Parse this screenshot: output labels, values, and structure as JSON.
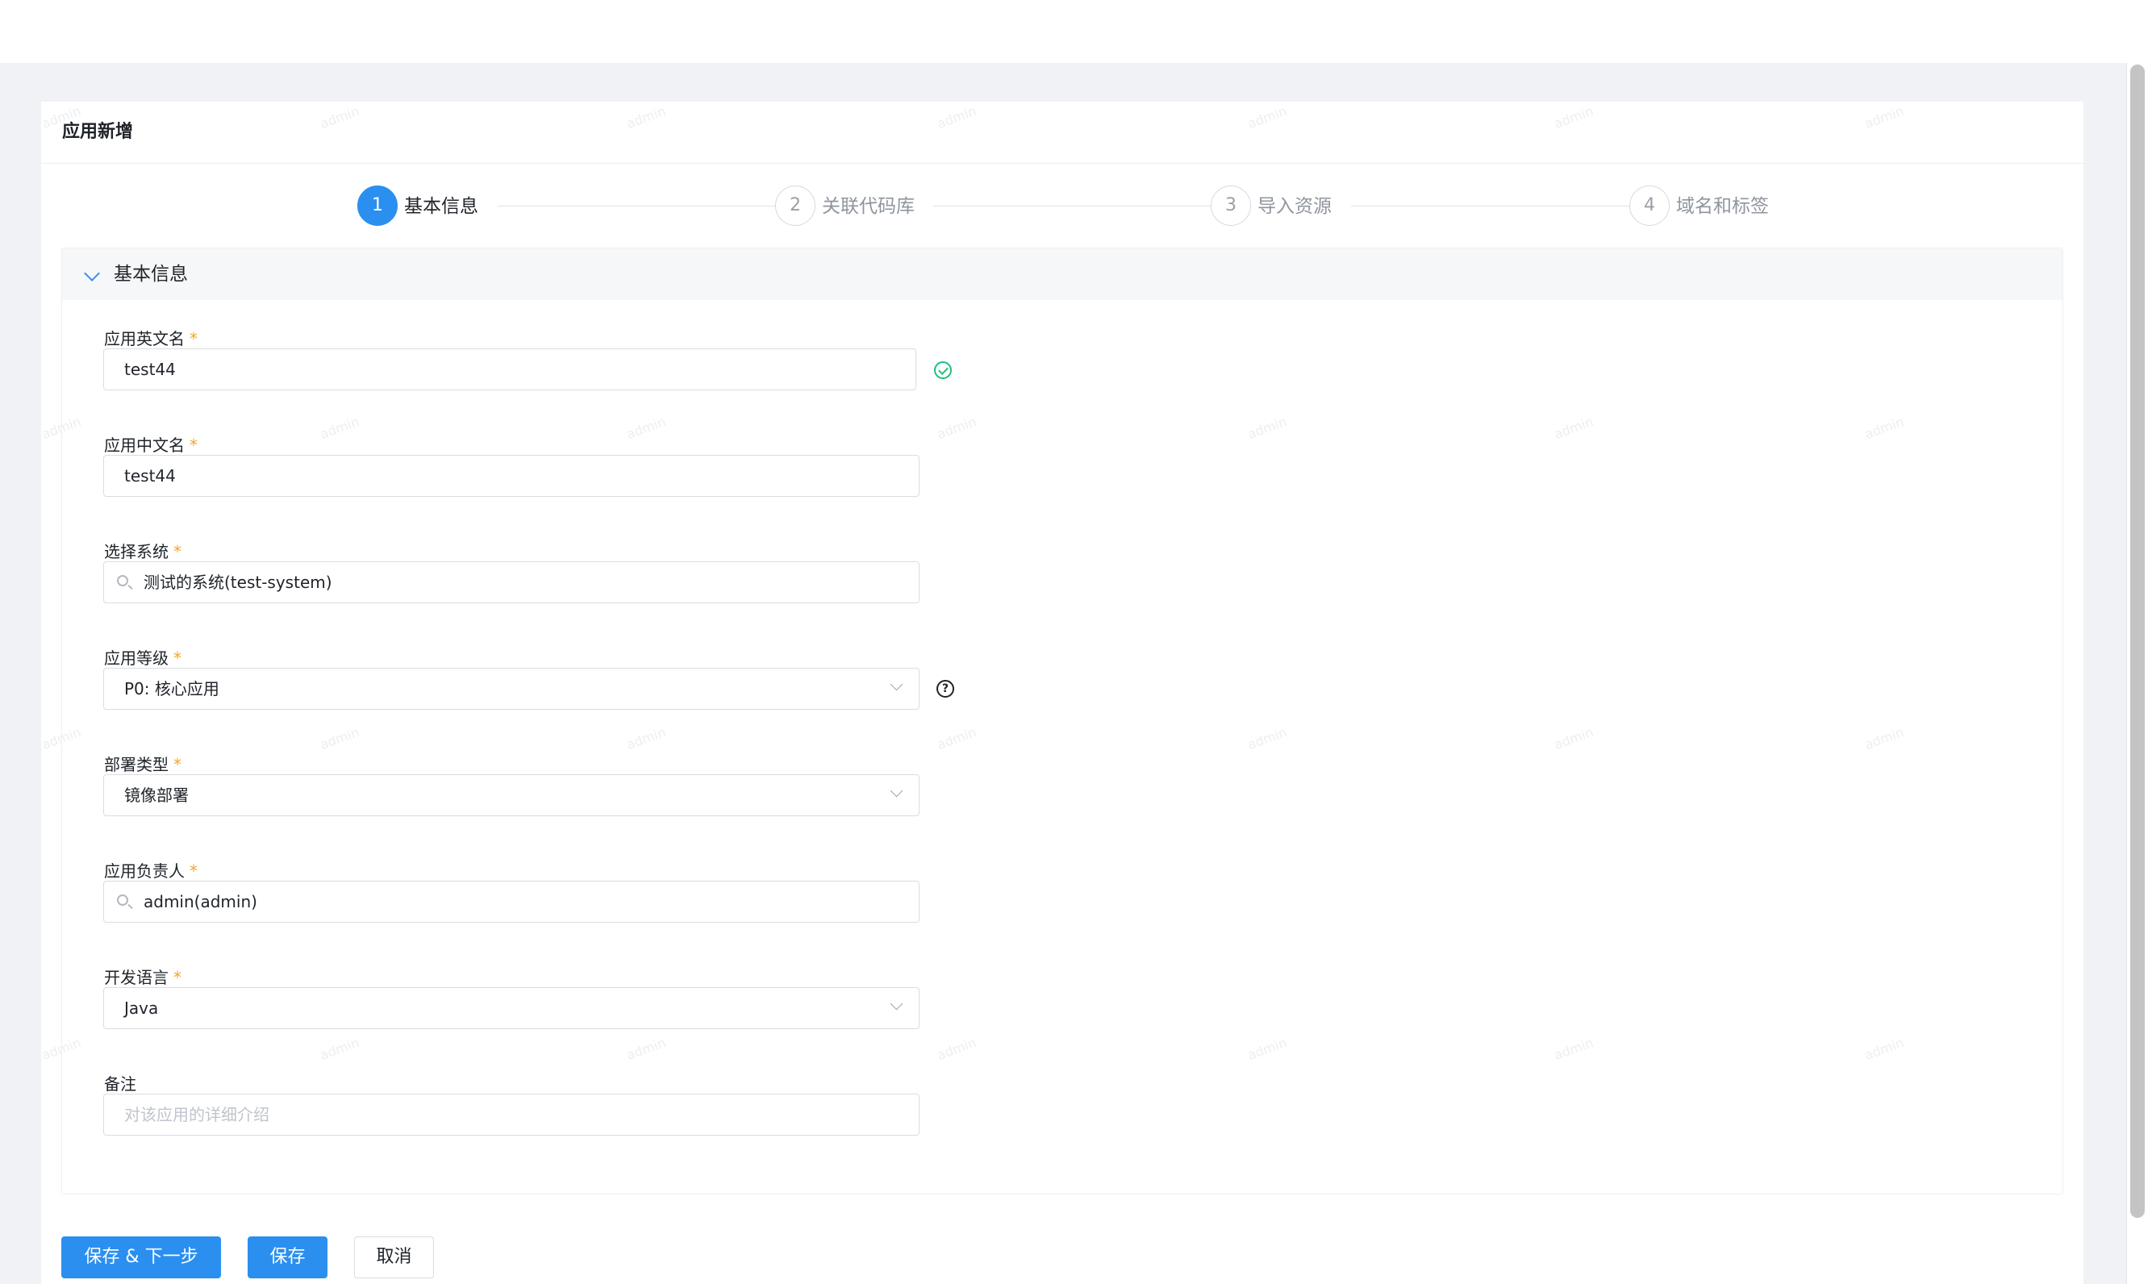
{
  "page": {
    "title": "应用新增",
    "watermark": "admin"
  },
  "steps": [
    {
      "number": "1",
      "label": "基本信息",
      "state": "active"
    },
    {
      "number": "2",
      "label": "关联代码库",
      "state": "pending"
    },
    {
      "number": "3",
      "label": "导入资源",
      "state": "pending"
    },
    {
      "number": "4",
      "label": "域名和标签",
      "state": "pending"
    }
  ],
  "section": {
    "title": "基本信息",
    "expanded": true
  },
  "form": {
    "required_mark": "*",
    "app_en_name": {
      "label": "应用英文名",
      "value": "test44",
      "validated": true
    },
    "app_cn_name": {
      "label": "应用中文名",
      "value": "test44"
    },
    "system": {
      "label": "选择系统",
      "value": "测试的系统(test-system)"
    },
    "level": {
      "label": "应用等级",
      "value": "P0: 核心应用",
      "help_icon_text": "?"
    },
    "deploy_type": {
      "label": "部署类型",
      "value": "镜像部署"
    },
    "owner": {
      "label": "应用负责人",
      "value": "admin(admin)"
    },
    "language": {
      "label": "开发语言",
      "value": "Java"
    },
    "remark": {
      "label": "备注",
      "placeholder": "对该应用的详细介绍",
      "value": ""
    }
  },
  "actions": {
    "save_next": "保存 & 下一步",
    "save": "保存",
    "cancel": "取消"
  },
  "colors": {
    "primary": "#2b8ff0",
    "success": "#1fbf7c",
    "required": "#f5a623",
    "page_bg": "#f0f2f5"
  }
}
